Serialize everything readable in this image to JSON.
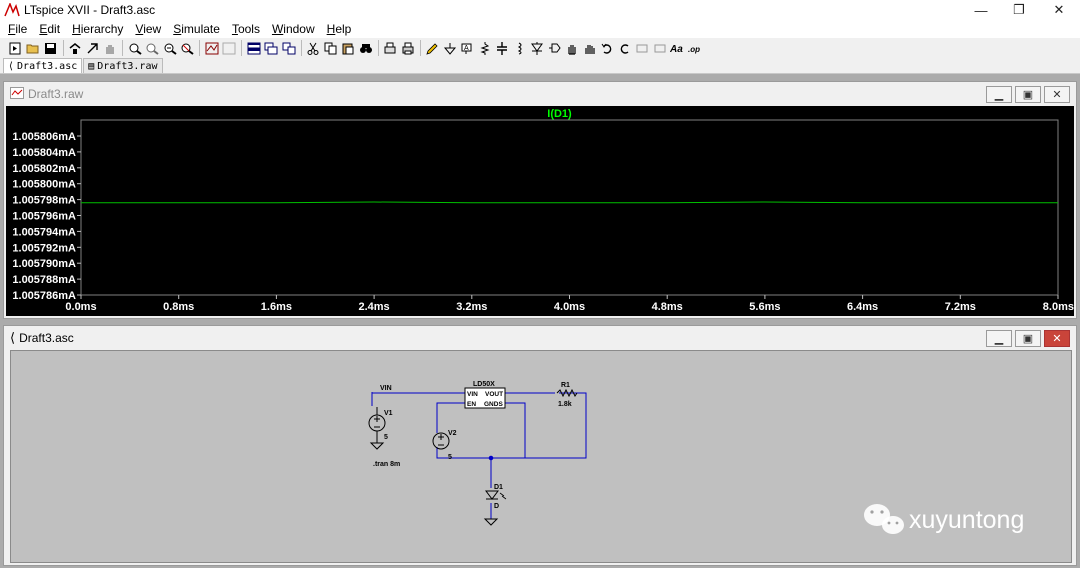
{
  "window": {
    "title": "LTspice XVII - Draft3.asc",
    "minimize": "—",
    "restore": "❐",
    "close": "✕"
  },
  "menu": [
    {
      "label": "File",
      "ul": "F",
      "rest": "ile"
    },
    {
      "label": "Edit",
      "ul": "E",
      "rest": "dit"
    },
    {
      "label": "Hierarchy",
      "ul": "H",
      "rest": "ierarchy"
    },
    {
      "label": "View",
      "ul": "V",
      "rest": "iew"
    },
    {
      "label": "Simulate",
      "ul": "S",
      "rest": "imulate"
    },
    {
      "label": "Tools",
      "ul": "T",
      "rest": "ools"
    },
    {
      "label": "Window",
      "ul": "W",
      "rest": "indow"
    },
    {
      "label": "Help",
      "ul": "H",
      "rest": "elp"
    }
  ],
  "tabs": [
    {
      "label": "Draft3.asc",
      "active": true
    },
    {
      "label": "Draft3.raw",
      "active": false
    }
  ],
  "waveform_window": {
    "title": "Draft3.raw"
  },
  "schematic_window": {
    "title": "Draft3.asc"
  },
  "chart_data": {
    "type": "line",
    "title": "I(D1)",
    "title_color": "#00ff00",
    "trace_color": "#00c000",
    "background": "#000000",
    "xlabel": "",
    "ylabel": "",
    "xlim": [
      0.0,
      8.0
    ],
    "ylim": [
      1.005786,
      1.005808
    ],
    "x_ticks": [
      "0.0ms",
      "0.8ms",
      "1.6ms",
      "2.4ms",
      "3.2ms",
      "4.0ms",
      "4.8ms",
      "5.6ms",
      "6.4ms",
      "7.2ms",
      "8.0ms"
    ],
    "y_ticks": [
      "1.005806mA",
      "1.005804mA",
      "1.005802mA",
      "1.005800mA",
      "1.005798mA",
      "1.005796mA",
      "1.005794mA",
      "1.005792mA",
      "1.005790mA",
      "1.005788mA",
      "1.005786mA"
    ],
    "series": [
      {
        "name": "I(D1)",
        "x": [
          0.0,
          0.8,
          1.6,
          2.4,
          3.2,
          4.0,
          4.8,
          5.6,
          6.4,
          7.2,
          8.0
        ],
        "values": [
          1.0057976,
          1.0057976,
          1.0057976,
          1.0057977,
          1.0057976,
          1.0057976,
          1.0057976,
          1.0057977,
          1.0057976,
          1.0057976,
          1.0057976
        ]
      }
    ]
  },
  "schematic": {
    "net_vin": "VIN",
    "v1_name": "V1",
    "v1_value": "5",
    "v2_name": "V2",
    "v2_value": "5",
    "ic_name": "LD50X",
    "ic_pin_vin": "VIN",
    "ic_pin_en": "EN",
    "ic_pin_vout": "VOUT",
    "ic_pin_gnds": "GNDS",
    "r1_name": "R1",
    "r1_value": "1.8k",
    "d1_name": "D1",
    "d1_value": "D",
    "directive": ".tran 8m",
    "wire_color": "#0000c8"
  },
  "watermark": {
    "text": "xuyuntong"
  }
}
